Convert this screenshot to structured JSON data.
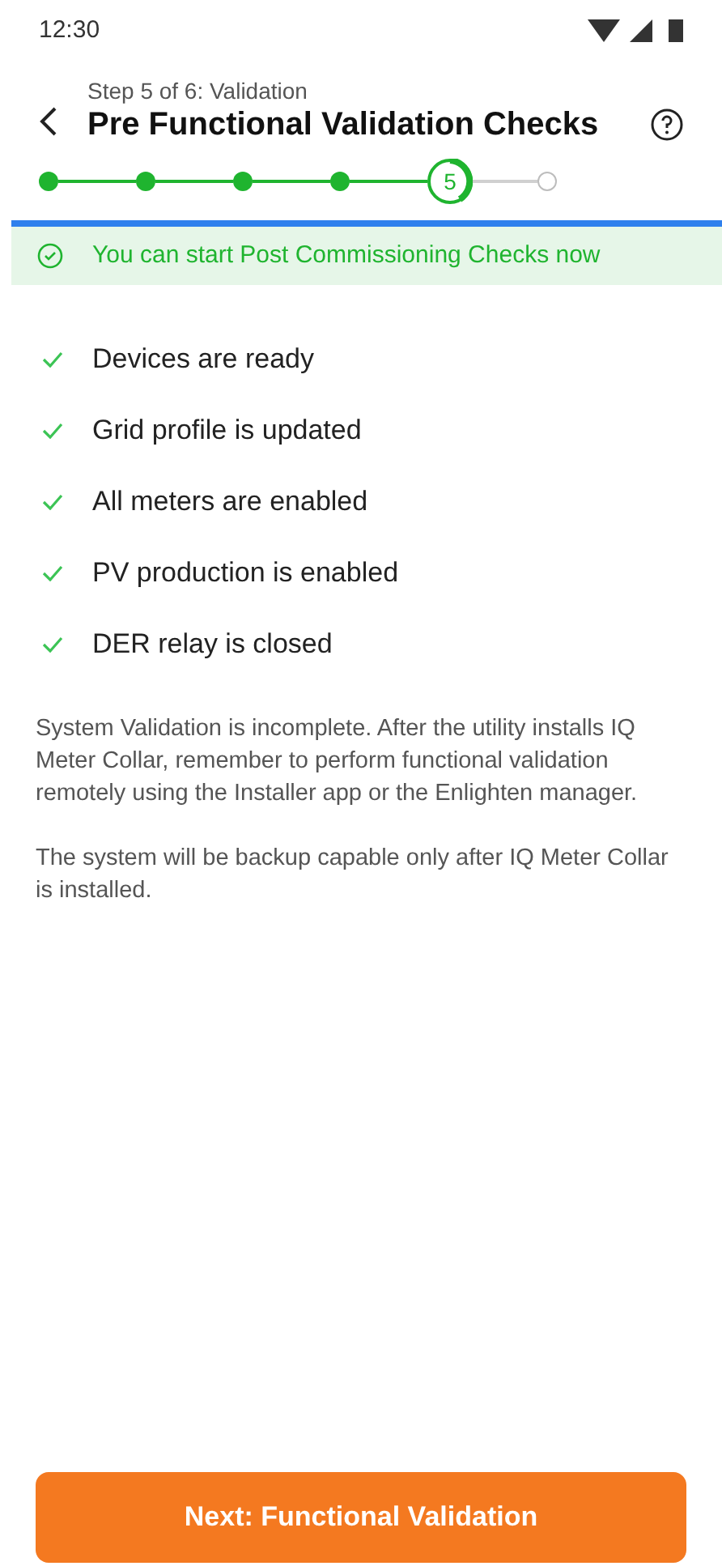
{
  "status_bar": {
    "time": "12:30"
  },
  "header": {
    "step": "Step 5 of 6: Validation",
    "title": "Pre Functional Validation Checks"
  },
  "stepper": [
    {
      "kind": "done"
    },
    {
      "kind": "done"
    },
    {
      "kind": "done"
    },
    {
      "kind": "done"
    },
    {
      "kind": "current",
      "label": "5"
    },
    {
      "kind": "pending"
    }
  ],
  "banner": {
    "text": "You can start Post Commissioning Checks now"
  },
  "checks": [
    {
      "label": "Devices are ready",
      "checked": true
    },
    {
      "label": "Grid profile is updated",
      "checked": true
    },
    {
      "label": "All meters are enabled",
      "checked": true
    },
    {
      "label": "PV production is enabled",
      "checked": true
    },
    {
      "label": "DER relay is closed",
      "checked": true
    }
  ],
  "notes": [
    "System Validation is incomplete. After the utility installs IQ Meter Collar, remember to perform functional validation remotely using the Installer app or the Enlighten manager.",
    "The system will be backup capable only after IQ Meter Collar is installed."
  ],
  "next_button": {
    "label": "Next: Functional Validation"
  }
}
